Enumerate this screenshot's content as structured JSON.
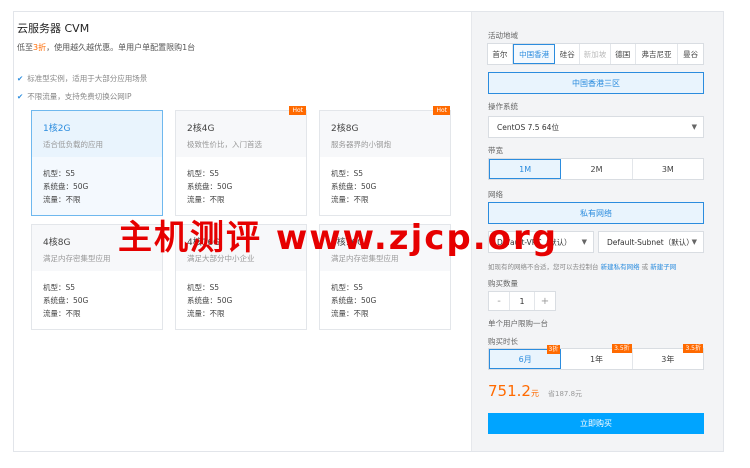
{
  "product": {
    "title": "云服务器 CVM",
    "subtitle_prefix": "低至",
    "subtitle_discount": "3折",
    "subtitle_suffix": "，使用越久越优惠。单用户单配置限购1台",
    "features": [
      "标准型实例，适用于大部分应用场景",
      "不限流量，支持免费切换公网IP"
    ]
  },
  "cards": [
    {
      "name": "1核2G",
      "desc": "适合低负载的应用",
      "model": "机型：S5",
      "disk": "系统盘：50G",
      "traffic": "流量：不限",
      "tag": ""
    },
    {
      "name": "2核4G",
      "desc": "极致性价比，入门首选",
      "model": "机型：S5",
      "disk": "系统盘：50G",
      "traffic": "流量：不限",
      "tag": "Hot"
    },
    {
      "name": "2核8G",
      "desc": "服务器界的小钢炮",
      "model": "机型：S5",
      "disk": "系统盘：50G",
      "traffic": "流量：不限",
      "tag": "Hot"
    },
    {
      "name": "4核8G",
      "desc": "满足内存密集型应用",
      "model": "机型：S5",
      "disk": "系统盘：50G",
      "traffic": "流量：不限",
      "tag": ""
    },
    {
      "name": "4核16G",
      "desc": "满足大部分中小企业",
      "model": "机型：S5",
      "disk": "系统盘：50G",
      "traffic": "流量：不限",
      "tag": ""
    },
    {
      "name": "8核16G",
      "desc": "满足内存密集型应用",
      "model": "机型：S5",
      "disk": "系统盘：50G",
      "traffic": "流量：不限",
      "tag": ""
    }
  ],
  "watermark": "主机测评  www.zjcp.org",
  "config": {
    "region_label": "活动地域",
    "regions": [
      "首尔",
      "中国香港",
      "硅谷",
      "新加坡",
      "德国",
      "弗吉尼亚",
      "曼谷"
    ],
    "zone": "中国香港三区",
    "os_label": "操作系统",
    "os_value": "CentOS 7.5 64位",
    "bandwidth_label": "带宽",
    "bandwidths": [
      "1M",
      "2M",
      "3M"
    ],
    "network_label": "网络",
    "network_type": "私有网络",
    "vpc_value": "Default-VPC（默认）",
    "subnet_value": "Default-Subnet（默认）",
    "hint_text": "如现有的网络不合适，您可以去控制台",
    "hint_link1": "新建私有网络",
    "hint_or": "或",
    "hint_link2": "新建子网",
    "qty_label": "购买数量",
    "qty_minus": "-",
    "qty_value": "1",
    "qty_plus": "+",
    "limit_note": "单个用户限购一台",
    "duration_label": "购买时长",
    "durations": [
      {
        "label": "6月",
        "tag": "3折"
      },
      {
        "label": "1年",
        "tag": "3.5折"
      },
      {
        "label": "3年",
        "tag": "3.5折"
      }
    ],
    "price_value": "751.2",
    "price_unit": "元",
    "saving": "省187.8元",
    "buy_label": "立即购买"
  }
}
